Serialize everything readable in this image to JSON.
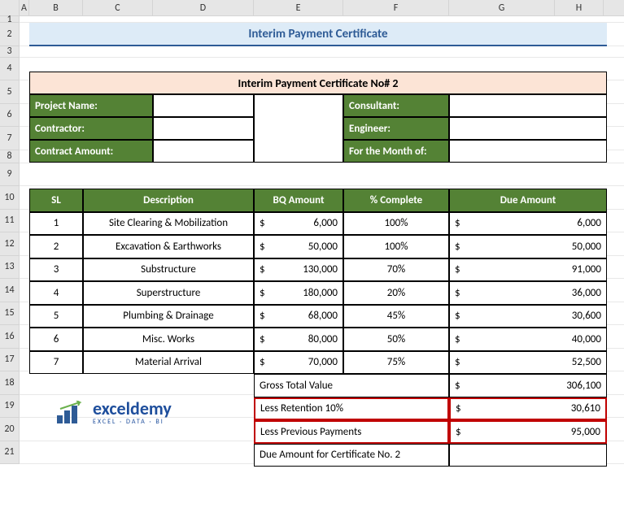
{
  "columns": [
    "",
    "A",
    "B",
    "C",
    "D",
    "E",
    "F",
    "G",
    "H"
  ],
  "rows": [
    "1",
    "2",
    "3",
    "4",
    "5",
    "6",
    "7",
    "8",
    "9",
    "10",
    "11",
    "12",
    "13",
    "14",
    "15",
    "16",
    "17",
    "18",
    "19",
    "20",
    "21"
  ],
  "title": "Interim Payment Certificate",
  "cert_header": "Interim Payment Certificate No# 2",
  "labels": {
    "project": "Project Name:",
    "contractor": "Contractor:",
    "contract_amount": "Contract Amount:",
    "consultant": "Consultant:",
    "engineer": "Engineer:",
    "month": "For the Month of:"
  },
  "headers": {
    "sl": "SL",
    "desc": "Description",
    "bq": "BQ Amount",
    "pct": "% Complete",
    "due": "Due Amount"
  },
  "items": [
    {
      "sl": "1",
      "desc": "Site Clearing & Mobilization",
      "bq": "6,000",
      "pct": "100%",
      "due": "6,000"
    },
    {
      "sl": "2",
      "desc": "Excavation & Earthworks",
      "bq": "50,000",
      "pct": "100%",
      "due": "50,000"
    },
    {
      "sl": "3",
      "desc": "Substructure",
      "bq": "130,000",
      "pct": "70%",
      "due": "91,000"
    },
    {
      "sl": "4",
      "desc": "Superstructure",
      "bq": "180,000",
      "pct": "20%",
      "due": "36,000"
    },
    {
      "sl": "5",
      "desc": "Plumbing & Drainage",
      "bq": "68,000",
      "pct": "45%",
      "due": "30,600"
    },
    {
      "sl": "6",
      "desc": "Misc. Works",
      "bq": "80,000",
      "pct": "50%",
      "due": "40,000"
    },
    {
      "sl": "7",
      "desc": "Material Arrival",
      "bq": "70,000",
      "pct": "75%",
      "due": "52,500"
    }
  ],
  "summary": {
    "gross_label": "Gross Total Value",
    "gross_value": "306,100",
    "retention_label": "Less Retention 10%",
    "retention_value": "30,610",
    "previous_label": "Less Previous Payments",
    "previous_value": "95,000",
    "due_label": "Due Amount for Certificate No. 2"
  },
  "logo": {
    "main": "exceldemy",
    "sub": "EXCEL · DATA · BI"
  },
  "currency": "$"
}
